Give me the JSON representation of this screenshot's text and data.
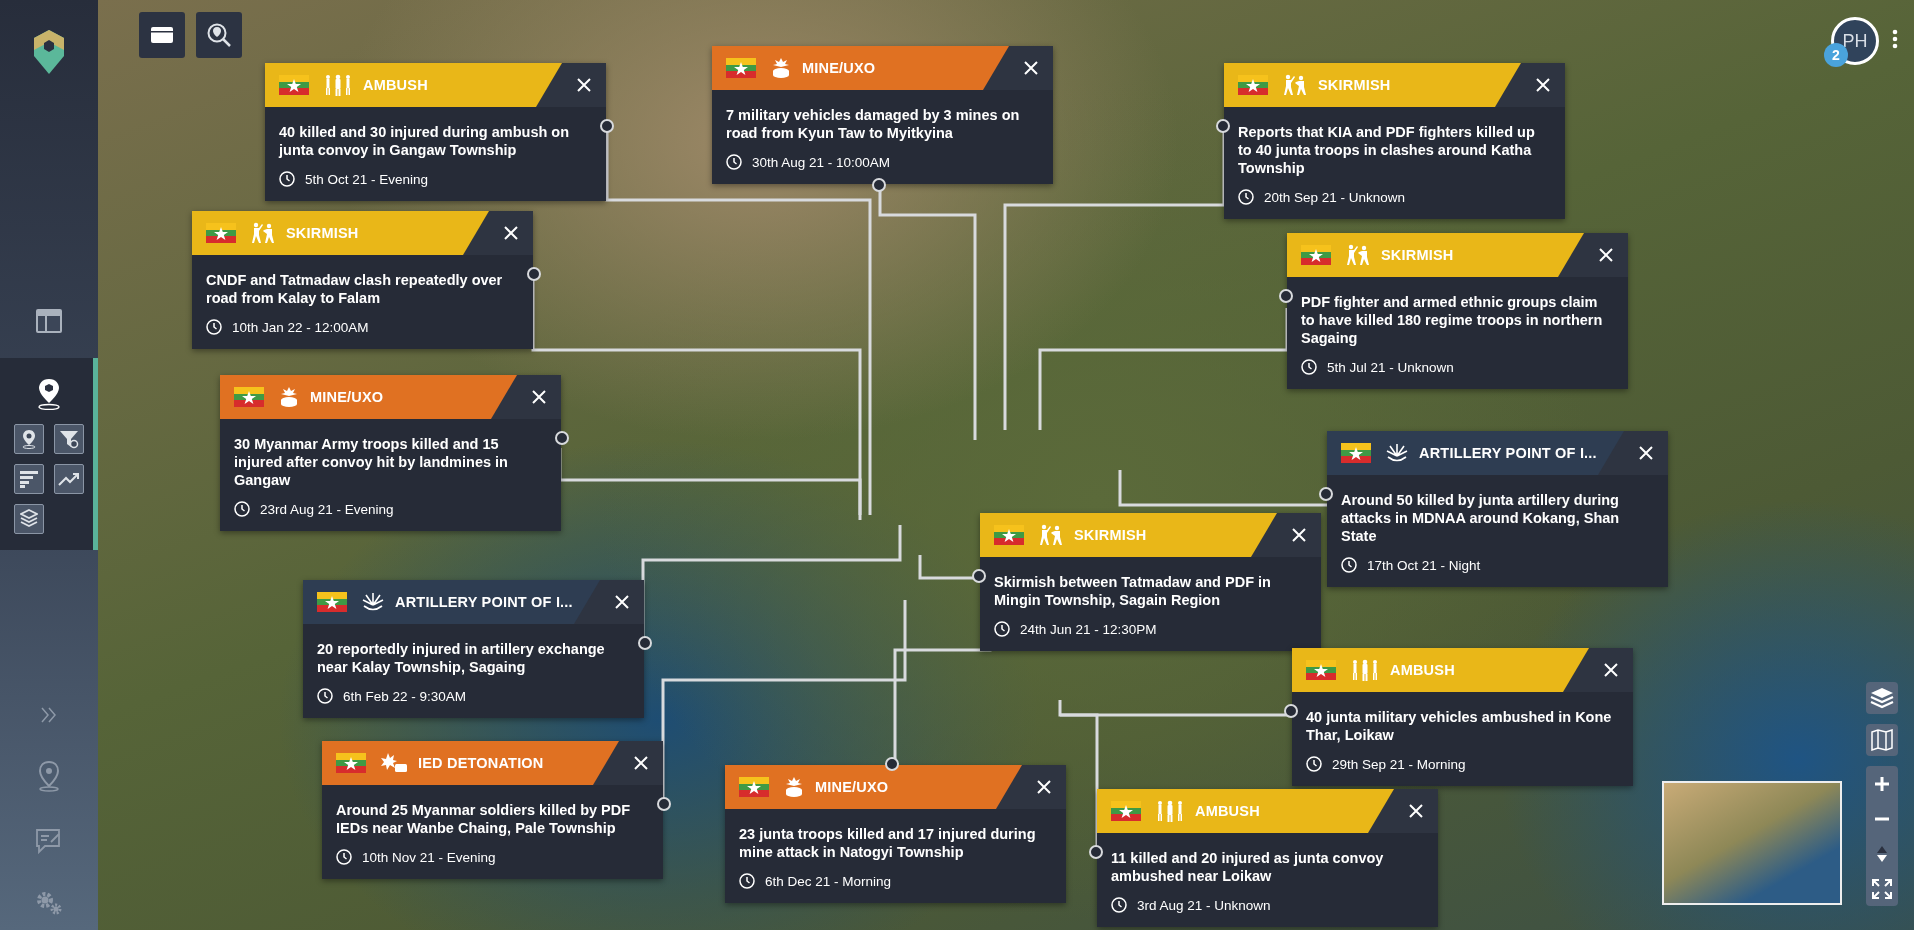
{
  "sidebar": {
    "items": [
      {
        "kind": "dashboard",
        "selected": false
      },
      {
        "kind": "map",
        "selected": true
      }
    ]
  },
  "user": {
    "initials": "PH",
    "badge": "2"
  },
  "cards": [
    {
      "kind": "ambush",
      "category": "AMBUSH",
      "color": "#e9b718",
      "summary": "40 killed and 30 injured during ambush on junta convoy in Gangaw Township",
      "time": "5th Oct 21 - Evening"
    },
    {
      "kind": "mine",
      "category": "MINE/UXO",
      "color": "#e07122",
      "summary": "7 military vehicles damaged by 3 mines on road from Kyun Taw to Myitkyina",
      "time": "30th Aug 21 - 10:00AM"
    },
    {
      "kind": "skirmish",
      "category": "SKIRMISH",
      "color": "#e9b718",
      "summary": "Reports that KIA and PDF fighters killed up to 40 junta troops in clashes around Katha Township",
      "time": "20th Sep 21 - Unknown"
    },
    {
      "kind": "skirmish",
      "category": "SKIRMISH",
      "color": "#e9b718",
      "summary": "CNDF and Tatmadaw clash repeatedly over road from Kalay to Falam",
      "time": "10th Jan 22 - 12:00AM"
    },
    {
      "kind": "skirmish",
      "category": "SKIRMISH",
      "color": "#e9b718",
      "summary": "PDF fighter and armed ethnic groups claim to have killed 180 regime troops in northern Sagaing",
      "time": "5th Jul 21 - Unknown"
    },
    {
      "kind": "mine",
      "category": "MINE/UXO",
      "color": "#e07122",
      "summary": "30 Myanmar Army troops killed and 15 injured after convoy hit by landmines in Gangaw",
      "time": "23rd Aug 21 - Evening"
    },
    {
      "kind": "artillery",
      "category": "ARTILLERY POINT OF I...",
      "color": "#2e3d52",
      "summary": "Around 50 killed by junta artillery during attacks in MDNAA around Kokang, Shan State",
      "time": "17th Oct 21 - Night"
    },
    {
      "kind": "skirmish",
      "category": "SKIRMISH",
      "color": "#e9b718",
      "summary": "Skirmish between Tatmadaw and PDF in Mingin Township, Sagain Region",
      "time": "24th Jun 21 - 12:30PM"
    },
    {
      "kind": "artillery",
      "category": "ARTILLERY POINT OF I...",
      "color": "#2e3d52",
      "summary": "20 reportedly injured in artillery exchange near Kalay Township, Sagaing",
      "time": "6th Feb 22 - 9:30AM"
    },
    {
      "kind": "ambush",
      "category": "AMBUSH",
      "color": "#e9b718",
      "summary": "40 junta military vehicles ambushed in Kone Thar, Loikaw",
      "time": "29th Sep 21 - Morning"
    },
    {
      "kind": "ied",
      "category": "IED DETONATION",
      "color": "#e07122",
      "summary": "Around 25 Myanmar soldiers killed by PDF IEDs near Wanbe Chaing, Pale Township",
      "time": "10th Nov 21 - Evening"
    },
    {
      "kind": "mine",
      "category": "MINE/UXO",
      "color": "#e07122",
      "summary": "23 junta troops killed and 17 injured during mine attack in Natogyi Township",
      "time": "6th Dec 21 - Morning"
    },
    {
      "kind": "ambush",
      "category": "AMBUSH",
      "color": "#e9b718",
      "summary": "11 killed and 20 injured as junta convoy ambushed near Loikaw",
      "time": "3rd Aug 21 - Unknown"
    }
  ]
}
